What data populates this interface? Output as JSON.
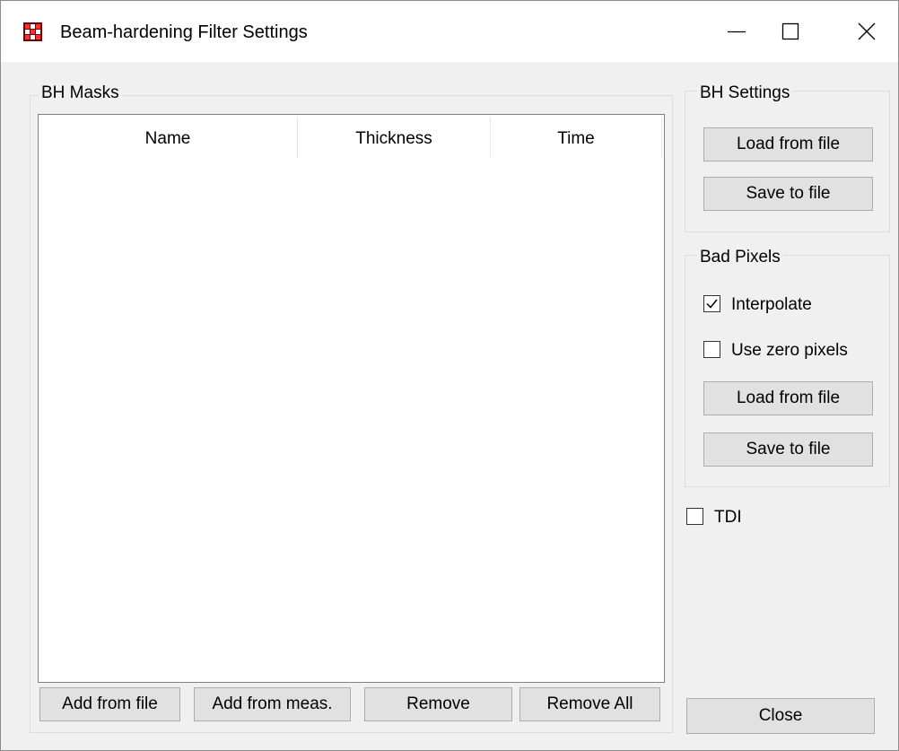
{
  "window": {
    "title": "Beam-hardening Filter Settings",
    "icon": "grid-app-icon",
    "controls": [
      "minimize-icon",
      "maximize-icon",
      "close-icon"
    ]
  },
  "bh_masks": {
    "label": "BH Masks",
    "columns": [
      "Name",
      "Thickness",
      "Time"
    ],
    "rows": [],
    "buttons": {
      "add_from_file": "Add from file",
      "add_from_meas": "Add from meas.",
      "remove": "Remove",
      "remove_all": "Remove All"
    }
  },
  "bh_settings": {
    "label": "BH Settings",
    "load": "Load from file",
    "save": "Save to file"
  },
  "bad_pixels": {
    "label": "Bad Pixels",
    "interpolate": {
      "label": "Interpolate",
      "checked": true
    },
    "use_zero": {
      "label": "Use zero pixels",
      "checked": false
    },
    "load": "Load from file",
    "save": "Save to file"
  },
  "tdi": {
    "label": "TDI",
    "checked": false
  },
  "close_button": "Close"
}
